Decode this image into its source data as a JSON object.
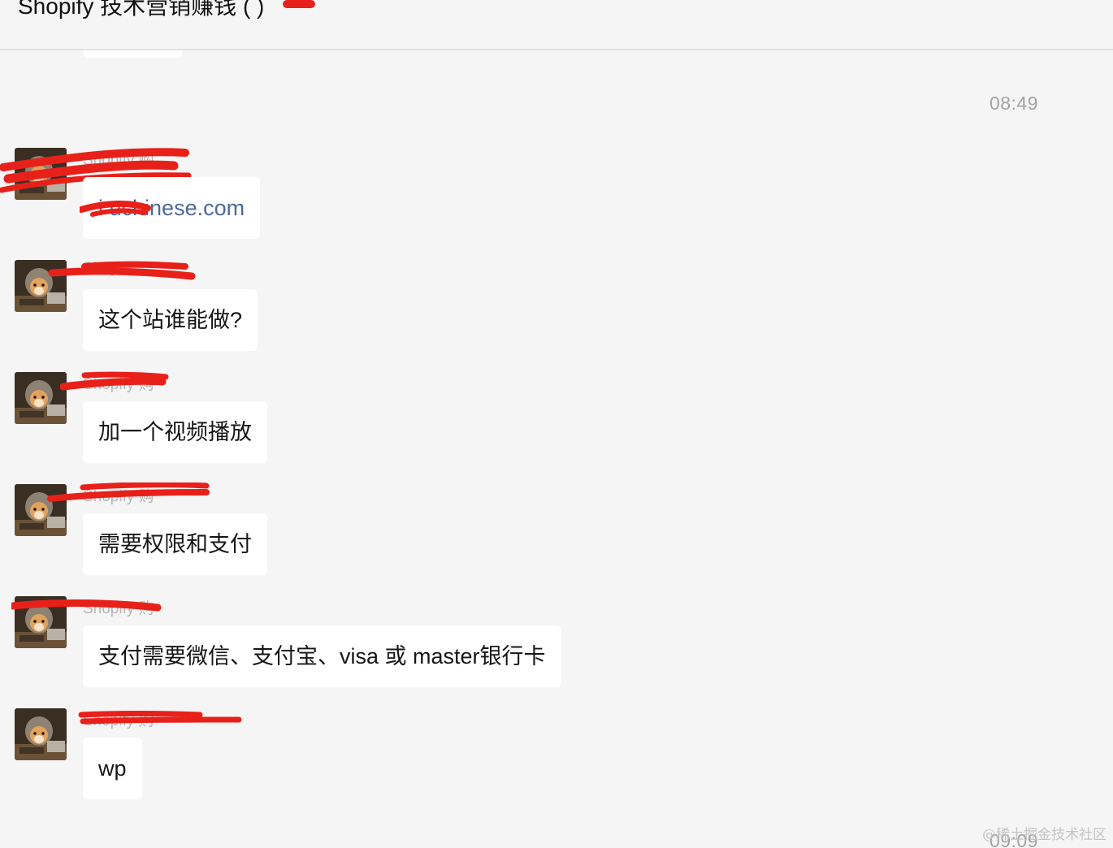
{
  "header": {
    "title": "Shopify 技术营销赚钱 (   )"
  },
  "timestamps": {
    "top": "08:49",
    "bottom": "09:09"
  },
  "messages": [
    {
      "sender": "Shopify 购",
      "text": "i   uchinese.com",
      "type": "link"
    },
    {
      "sender": "Shop   ",
      "text": "这个站谁能做?",
      "type": "text"
    },
    {
      "sender": "Shopify 购",
      "text": "加一个视频播放",
      "type": "text"
    },
    {
      "sender": "Shopify 购",
      "text": "需要权限和支付",
      "type": "text"
    },
    {
      "sender": "Shopify 购",
      "text": "支付需要微信、支付宝、visa 或 master银行卡",
      "type": "text"
    },
    {
      "sender": "Shopify 购",
      "text": "wp",
      "type": "text"
    }
  ],
  "watermark": "@稀土掘金技术社区",
  "colors": {
    "background": "#f5f5f5",
    "bubble": "#ffffff",
    "link": "#4a6a97",
    "redaction": "#e8201a",
    "timestamp": "#a3a3a3"
  },
  "icons": {
    "avatar": "shiba-dog-avatar"
  }
}
